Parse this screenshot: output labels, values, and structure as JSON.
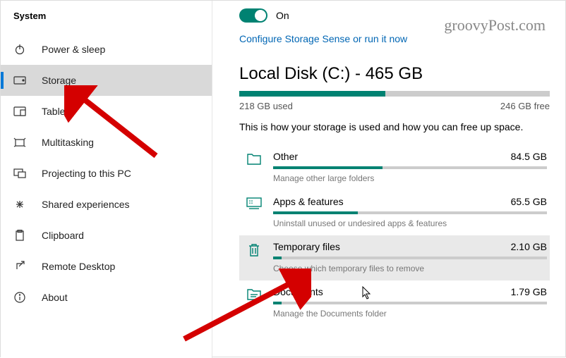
{
  "sidebar": {
    "title": "System",
    "items": [
      {
        "label": "Power & sleep"
      },
      {
        "label": "Storage"
      },
      {
        "label": "Tablet"
      },
      {
        "label": "Multitasking"
      },
      {
        "label": "Projecting to this PC"
      },
      {
        "label": "Shared experiences"
      },
      {
        "label": "Clipboard"
      },
      {
        "label": "Remote Desktop"
      },
      {
        "label": "About"
      }
    ]
  },
  "toggle": {
    "label": "On"
  },
  "configure_link": "Configure Storage Sense or run it now",
  "disk": {
    "title": "Local Disk (C:) - 465 GB",
    "used_label": "218 GB used",
    "free_label": "246 GB free",
    "fill_pct": 47
  },
  "description": "This is how your storage is used and how you can free up space.",
  "categories": [
    {
      "name": "Other",
      "size": "84.5 GB",
      "sub": "Manage other large folders",
      "pct": 40
    },
    {
      "name": "Apps & features",
      "size": "65.5 GB",
      "sub": "Uninstall unused or undesired apps & features",
      "pct": 31
    },
    {
      "name": "Temporary files",
      "size": "2.10 GB",
      "sub": "Choose which temporary files to remove",
      "pct": 3
    },
    {
      "name": "Documents",
      "size": "1.79 GB",
      "sub": "Manage the Documents folder",
      "pct": 3
    }
  ],
  "watermark": "groovyPost.com"
}
